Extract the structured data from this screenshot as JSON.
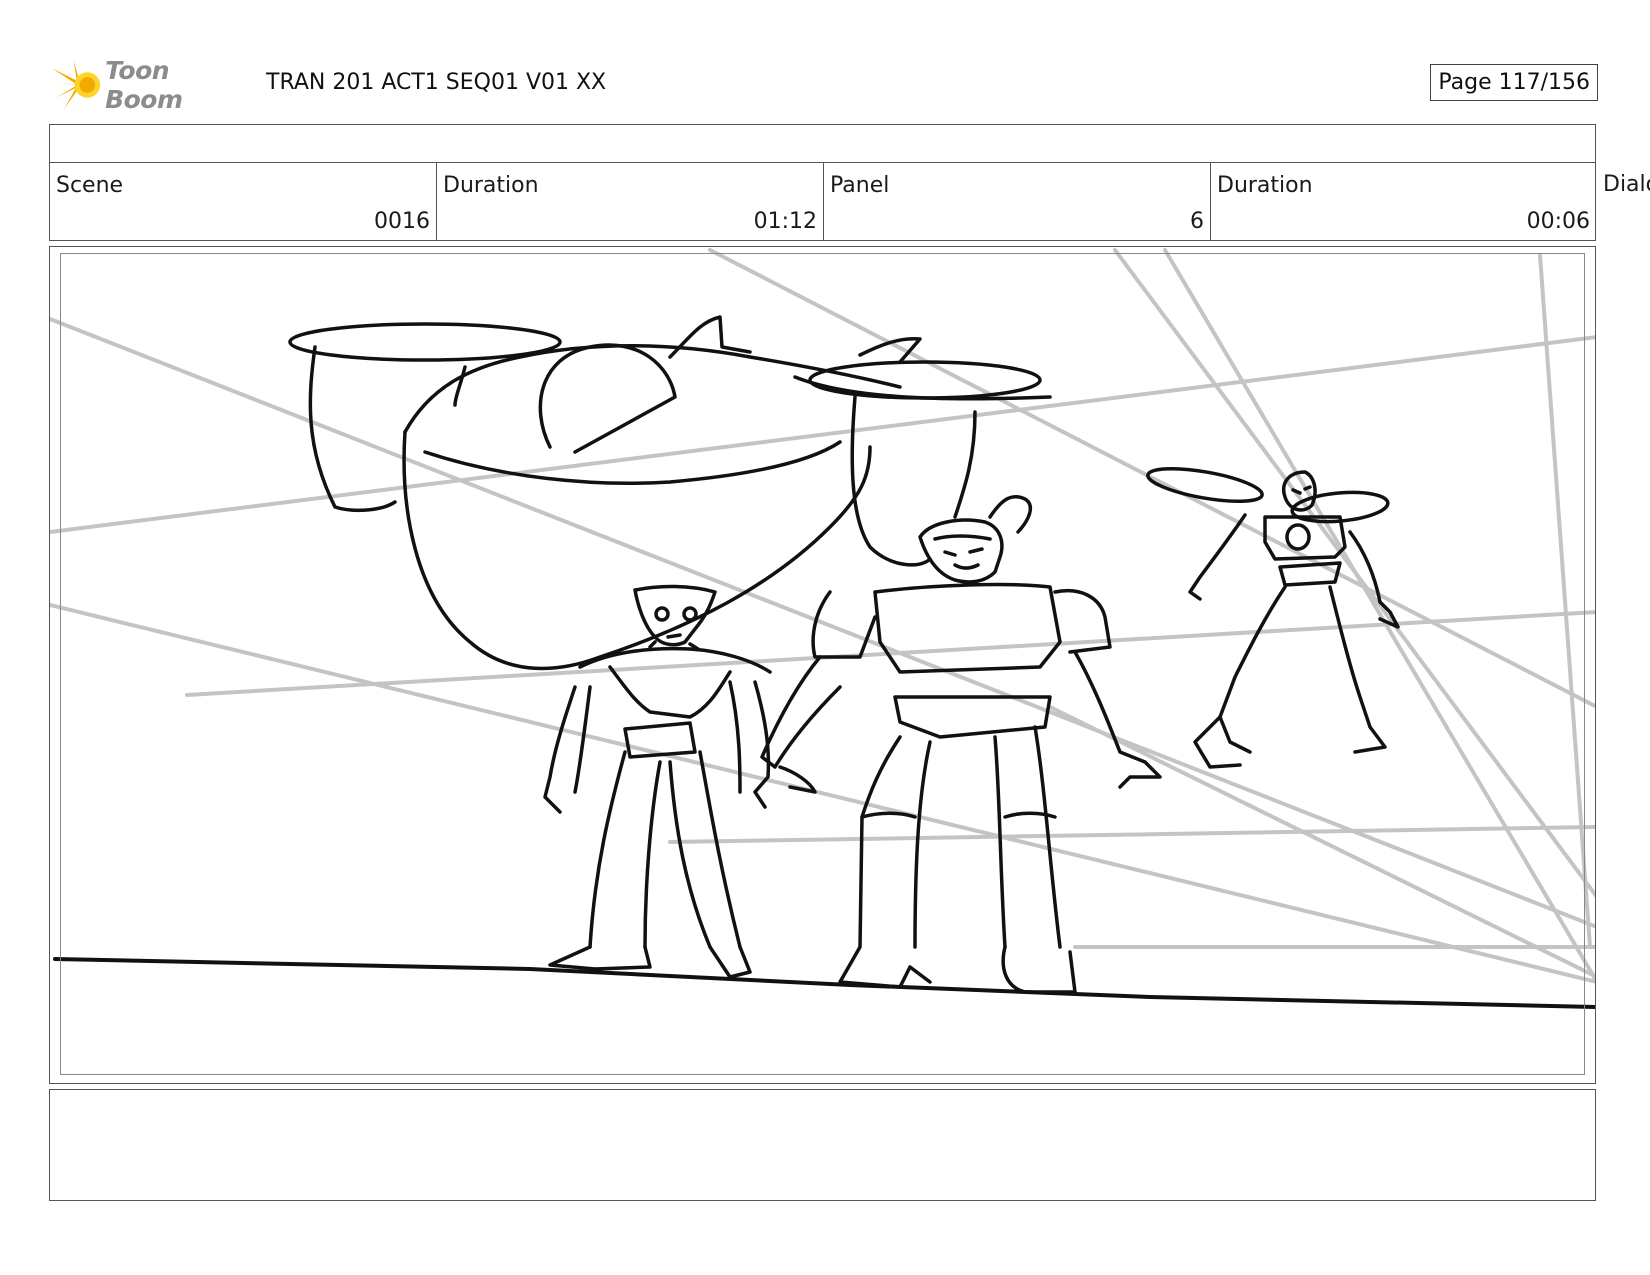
{
  "header": {
    "logo_text": "Toon Boom",
    "title": "TRAN 201 ACT1 SEQ01 V01 XX",
    "page": "Page 117/156"
  },
  "info": {
    "scene_label": "Scene",
    "scene_value": "0016",
    "duration_label": "Duration",
    "duration_value": "01:12",
    "panel_label": "Panel",
    "panel_value": "6",
    "panel_duration_label": "Duration",
    "panel_duration_value": "00:06",
    "dialog_label": "Dialog"
  },
  "colors": {
    "logo_orange": "#f2a900",
    "logo_yellow": "#ffd42a",
    "logo_gray": "#8c8c8c",
    "border": "#555555",
    "sketch_line": "#111111",
    "guide_line": "#c4c4c4"
  }
}
